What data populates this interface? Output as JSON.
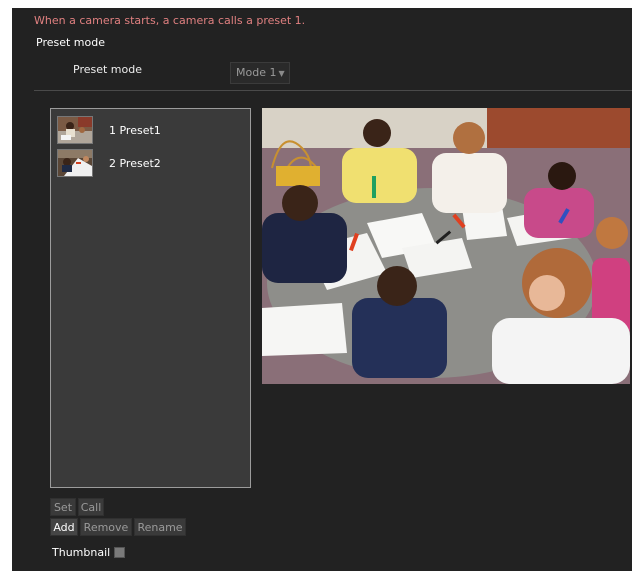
{
  "header": {
    "notice": "When a camera starts, a camera calls a preset 1.",
    "section_title": "Preset mode"
  },
  "preset_mode": {
    "label": "Preset mode",
    "selected": "Mode 1",
    "caret": "▼"
  },
  "presets": [
    {
      "number": "1",
      "name": "Preset1",
      "display": "1 Preset1"
    },
    {
      "number": "2",
      "name": "Preset2",
      "display": "2 Preset2"
    }
  ],
  "buttons": {
    "set": "Set",
    "call": "Call",
    "add": "Add",
    "remove": "Remove",
    "rename": "Rename"
  },
  "thumbnail": {
    "label": "Thumbnail",
    "checked": false
  },
  "colors": {
    "panel_bg": "#222222",
    "notice_text": "#e08080",
    "list_bg": "#3a3a3a",
    "list_border": "#9c9c9c"
  }
}
